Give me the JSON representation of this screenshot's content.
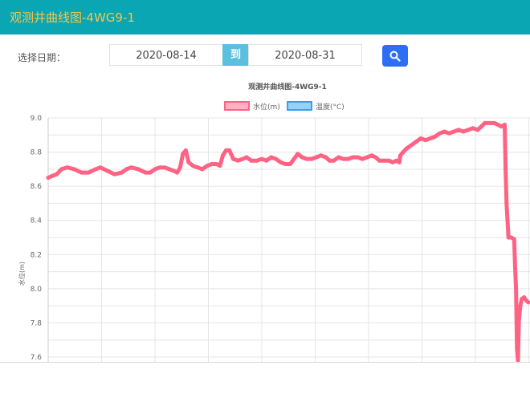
{
  "window": {
    "title": "观测井曲线图-4WG9-1"
  },
  "filters": {
    "date_label": "选择日期：",
    "start_date": "2020-08-14",
    "to_label": "到",
    "end_date": "2020-08-31"
  },
  "colors": {
    "header": "#0aa6b3",
    "title_text": "#f3c64b",
    "series_water": "#ff6384",
    "series_temp": "#36a2eb",
    "search_button": "#2f6ef4"
  },
  "chart_data": {
    "type": "line",
    "title": "观测井曲线图-4WG9-1",
    "ylabel": "水位(m)",
    "ylim": [
      7.6,
      9.0
    ],
    "y_ticks": [
      "9.0",
      "8.8",
      "8.6",
      "8.4",
      "8.2",
      "8.0",
      "7.8",
      "7.6"
    ],
    "legend_position": "top-center",
    "grid": true,
    "series": [
      {
        "name": "水位(m)",
        "values": [
          [
            0.0,
            8.65
          ],
          [
            0.008,
            8.66
          ],
          [
            0.018,
            8.67
          ],
          [
            0.028,
            8.7
          ],
          [
            0.04,
            8.71
          ],
          [
            0.055,
            8.7
          ],
          [
            0.07,
            8.68
          ],
          [
            0.085,
            8.68
          ],
          [
            0.1,
            8.7
          ],
          [
            0.11,
            8.71
          ],
          [
            0.125,
            8.69
          ],
          [
            0.14,
            8.67
          ],
          [
            0.155,
            8.68
          ],
          [
            0.165,
            8.7
          ],
          [
            0.175,
            8.71
          ],
          [
            0.19,
            8.7
          ],
          [
            0.205,
            8.68
          ],
          [
            0.215,
            8.68
          ],
          [
            0.225,
            8.7
          ],
          [
            0.235,
            8.71
          ],
          [
            0.245,
            8.71
          ],
          [
            0.255,
            8.7
          ],
          [
            0.265,
            8.69
          ],
          [
            0.272,
            8.68
          ],
          [
            0.278,
            8.71
          ],
          [
            0.284,
            8.79
          ],
          [
            0.29,
            8.81
          ],
          [
            0.296,
            8.74
          ],
          [
            0.305,
            8.72
          ],
          [
            0.315,
            8.71
          ],
          [
            0.325,
            8.7
          ],
          [
            0.335,
            8.72
          ],
          [
            0.345,
            8.73
          ],
          [
            0.355,
            8.73
          ],
          [
            0.362,
            8.72
          ],
          [
            0.368,
            8.78
          ],
          [
            0.375,
            8.81
          ],
          [
            0.382,
            8.81
          ],
          [
            0.39,
            8.76
          ],
          [
            0.4,
            8.75
          ],
          [
            0.41,
            8.76
          ],
          [
            0.418,
            8.77
          ],
          [
            0.428,
            8.75
          ],
          [
            0.44,
            8.75
          ],
          [
            0.45,
            8.76
          ],
          [
            0.46,
            8.75
          ],
          [
            0.47,
            8.77
          ],
          [
            0.48,
            8.76
          ],
          [
            0.49,
            8.74
          ],
          [
            0.5,
            8.73
          ],
          [
            0.51,
            8.73
          ],
          [
            0.518,
            8.76
          ],
          [
            0.526,
            8.79
          ],
          [
            0.535,
            8.77
          ],
          [
            0.545,
            8.76
          ],
          [
            0.555,
            8.76
          ],
          [
            0.565,
            8.77
          ],
          [
            0.575,
            8.78
          ],
          [
            0.585,
            8.77
          ],
          [
            0.593,
            8.75
          ],
          [
            0.602,
            8.75
          ],
          [
            0.612,
            8.77
          ],
          [
            0.622,
            8.76
          ],
          [
            0.632,
            8.76
          ],
          [
            0.642,
            8.77
          ],
          [
            0.652,
            8.77
          ],
          [
            0.662,
            8.76
          ],
          [
            0.672,
            8.77
          ],
          [
            0.682,
            8.78
          ],
          [
            0.69,
            8.77
          ],
          [
            0.698,
            8.75
          ],
          [
            0.708,
            8.75
          ],
          [
            0.718,
            8.75
          ],
          [
            0.726,
            8.74
          ],
          [
            0.734,
            8.75
          ],
          [
            0.74,
            8.74
          ],
          [
            0.742,
            8.78
          ],
          [
            0.748,
            8.8
          ],
          [
            0.755,
            8.82
          ],
          [
            0.765,
            8.84
          ],
          [
            0.775,
            8.86
          ],
          [
            0.785,
            8.88
          ],
          [
            0.795,
            8.87
          ],
          [
            0.805,
            8.88
          ],
          [
            0.815,
            8.89
          ],
          [
            0.825,
            8.91
          ],
          [
            0.835,
            8.92
          ],
          [
            0.845,
            8.91
          ],
          [
            0.855,
            8.92
          ],
          [
            0.865,
            8.93
          ],
          [
            0.875,
            8.92
          ],
          [
            0.885,
            8.93
          ],
          [
            0.895,
            8.94
          ],
          [
            0.905,
            8.93
          ],
          [
            0.913,
            8.95
          ],
          [
            0.92,
            8.97
          ],
          [
            0.93,
            8.97
          ],
          [
            0.94,
            8.97
          ],
          [
            0.948,
            8.96
          ],
          [
            0.955,
            8.95
          ],
          [
            0.962,
            8.96
          ],
          [
            0.964,
            8.7
          ],
          [
            0.966,
            8.5
          ],
          [
            0.968,
            8.4
          ],
          [
            0.97,
            8.3
          ],
          [
            0.976,
            8.3
          ],
          [
            0.982,
            8.29
          ],
          [
            0.984,
            8.12
          ],
          [
            0.986,
            8.0
          ],
          [
            0.988,
            7.65
          ],
          [
            0.99,
            7.58
          ],
          [
            0.992,
            7.82
          ],
          [
            0.995,
            7.9
          ],
          [
            0.998,
            7.94
          ],
          [
            1.003,
            7.95
          ],
          [
            1.008,
            7.93
          ],
          [
            1.012,
            7.92
          ]
        ]
      },
      {
        "name": "温度(°C)",
        "values": []
      }
    ]
  }
}
